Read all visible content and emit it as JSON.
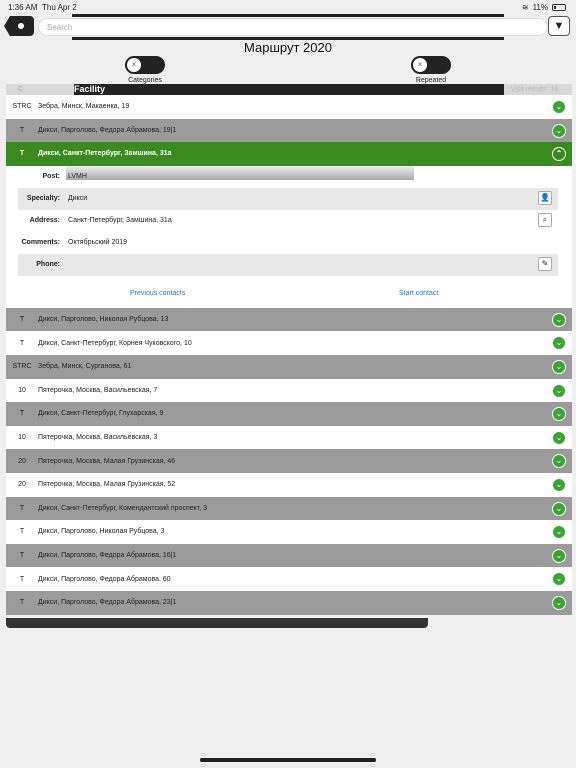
{
  "status": {
    "time": "1:36 AM",
    "date": "Thu Apr 2",
    "battery": "11%"
  },
  "search": {
    "placeholder": "Search"
  },
  "title": "Маршрут 2020",
  "toggles": {
    "categories": "Categories",
    "repeated": "Repeated"
  },
  "header": {
    "c": "C",
    "facility": "Facility",
    "next": "Visit results: 18"
  },
  "rows": [
    {
      "code": "STRC",
      "addr": "Зебра, Минск, Макаенка, 19",
      "style": "light"
    },
    {
      "code": "T",
      "addr": "Дикси, Парголово, Федора Абрамова, 19|1",
      "style": "dark"
    },
    {
      "code": "T",
      "addr": "Дикси, Санкт-Петербург, Замшина, 31а",
      "style": "active"
    }
  ],
  "detail": {
    "post_label": "Post:",
    "post_value": "LVMH",
    "specialty_label": "Specialty:",
    "specialty_value": "Дикси",
    "address_label": "Address:",
    "address_value": "Санкт-Петербург, Замшина, 31а",
    "comments_label": "Comments:",
    "comments_value": "Октябрьский 2019",
    "phone_label": "Phone:",
    "phone_value": "",
    "previous_contacts": "Previous contacts",
    "start_contact": "Start contact"
  },
  "rows_after": [
    {
      "code": "T",
      "addr": "Дикси, Парголово, Николая Рубцова, 13",
      "style": "dark"
    },
    {
      "code": "T",
      "addr": "Дикси, Санкт-Петербург, Корнея Чуковского, 10",
      "style": "light"
    },
    {
      "code": "STRC",
      "addr": "Зебра, Минск, Сурганова, 61",
      "style": "dark"
    },
    {
      "code": "10",
      "addr": "Пятерочка, Москва, Васильевская, 7",
      "style": "light"
    },
    {
      "code": "T",
      "addr": "Дикси, Санкт-Петербург, Глухарская, 9",
      "style": "dark"
    },
    {
      "code": "10",
      "addr": "Пятерочка, Москва, Васильевская, 3",
      "style": "light"
    },
    {
      "code": "20",
      "addr": "Пятерочка, Москва, Малая Грузинская, 46",
      "style": "dark"
    },
    {
      "code": "20",
      "addr": "Пятерочка, Москва, Малая Грузинская, 52",
      "style": "light"
    },
    {
      "code": "T",
      "addr": "Дикси, Санкт-Петербург, Комендантский проспект, 3",
      "style": "dark"
    },
    {
      "code": "T",
      "addr": "Дикси, Парголово, Николая Рубцова, 3",
      "style": "light"
    },
    {
      "code": "T",
      "addr": "Дикси, Парголово, Федора Абрамова, 16|1",
      "style": "dark"
    },
    {
      "code": "T",
      "addr": "Дикси, Парголово, Федора Абрамова, 60",
      "style": "light"
    },
    {
      "code": "T",
      "addr": "Дикси, Парголово, Федора Абрамова, 23|1",
      "style": "dark"
    }
  ]
}
